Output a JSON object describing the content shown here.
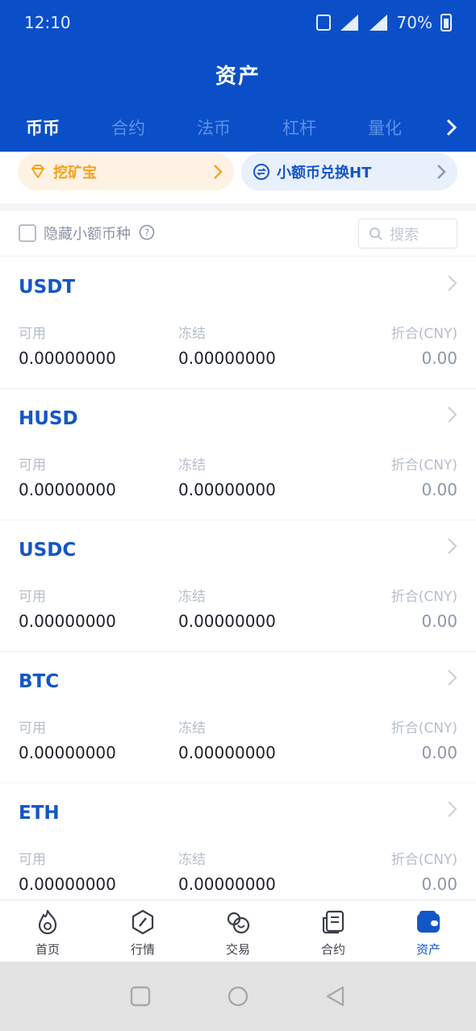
{
  "status_bar": {
    "time": "12:10",
    "battery": "70%"
  },
  "header": {
    "title": "资产"
  },
  "tabs": [
    {
      "label": "币币",
      "active": true
    },
    {
      "label": "合约",
      "active": false
    },
    {
      "label": "法币",
      "active": false
    },
    {
      "label": "杠杆",
      "active": false
    },
    {
      "label": "量化",
      "active": false
    }
  ],
  "promos": {
    "mining": {
      "label": "挖矿宝",
      "icon": "diamond-icon"
    },
    "convert": {
      "label": "小额币兑换HT",
      "icon": "exchange-icon"
    }
  },
  "filter": {
    "hide_small_label": "隐藏小额币种",
    "hide_small_checked": false,
    "search_placeholder": "搜索"
  },
  "columns": {
    "available": "可用",
    "frozen": "冻结",
    "converted": "折合(CNY)"
  },
  "assets": [
    {
      "name": "USDT",
      "available": "0.00000000",
      "frozen": "0.00000000",
      "cny": "0.00"
    },
    {
      "name": "HUSD",
      "available": "0.00000000",
      "frozen": "0.00000000",
      "cny": "0.00"
    },
    {
      "name": "USDC",
      "available": "0.00000000",
      "frozen": "0.00000000",
      "cny": "0.00"
    },
    {
      "name": "BTC",
      "available": "0.00000000",
      "frozen": "0.00000000",
      "cny": "0.00"
    },
    {
      "name": "ETH",
      "available": "0.00000000",
      "frozen": "0.00000000",
      "cny": "0.00"
    }
  ],
  "bottom_nav": [
    {
      "label": "首页",
      "icon": "flame-icon",
      "active": false
    },
    {
      "label": "行情",
      "icon": "compass-icon",
      "active": false
    },
    {
      "label": "交易",
      "icon": "swap-icon",
      "active": false
    },
    {
      "label": "合约",
      "icon": "document-icon",
      "active": false
    },
    {
      "label": "资产",
      "icon": "wallet-icon",
      "active": true
    }
  ],
  "colors": {
    "brand": "#0a4fc8",
    "accent": "#1456c7",
    "mining_orange": "#f6a220"
  }
}
